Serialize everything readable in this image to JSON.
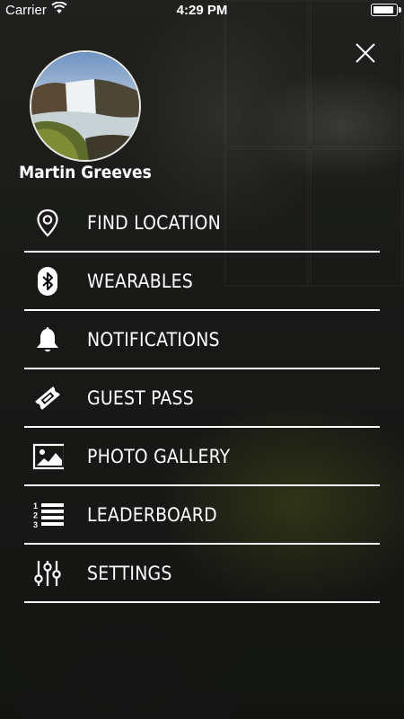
{
  "status_bar": {
    "carrier": "Carrier",
    "time": "4:29 PM",
    "battery_level": 0.92,
    "icons": [
      "wifi-icon",
      "battery-icon"
    ]
  },
  "profile": {
    "name": "Martin Greeves",
    "avatar_icon": "waterfall-photo"
  },
  "menu": {
    "items": [
      {
        "label": "FIND LOCATION",
        "icon": "map-pin-icon"
      },
      {
        "label": "WEARABLES",
        "icon": "bluetooth-icon"
      },
      {
        "label": "NOTIFICATIONS",
        "icon": "bell-icon"
      },
      {
        "label": "GUEST PASS",
        "icon": "ticket-icon"
      },
      {
        "label": "PHOTO GALLERY",
        "icon": "image-icon"
      },
      {
        "label": "LEADERBOARD",
        "icon": "numbered-list-icon"
      },
      {
        "label": "SETTINGS",
        "icon": "sliders-icon"
      }
    ]
  },
  "colors": {
    "text": "#ffffff",
    "divider": "#ffffff",
    "overlay": "#000000"
  }
}
